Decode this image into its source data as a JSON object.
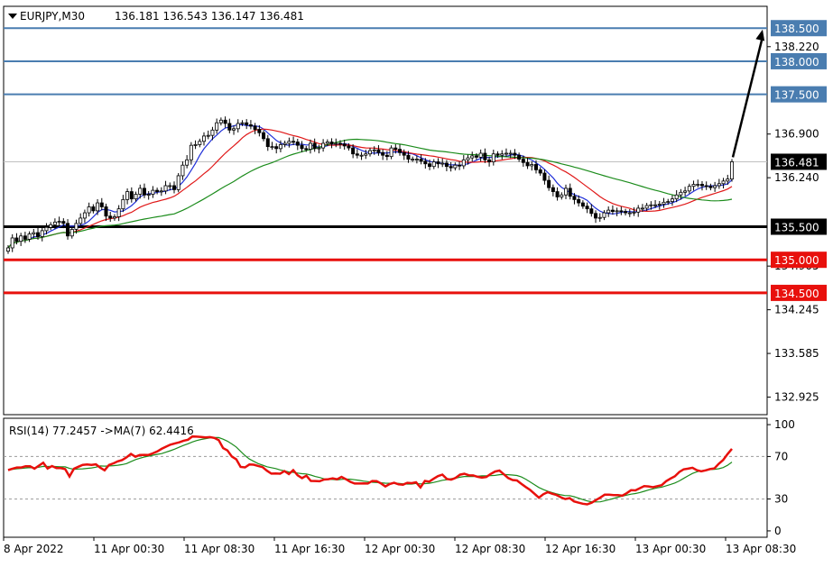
{
  "chart_data": [
    {
      "type": "candlestick",
      "header": {
        "symbol": "EURJPY,M30",
        "ohlc": "136.181 136.543 136.147 136.481"
      },
      "ylim": [
        132.66,
        138.83
      ],
      "y_ticks": [
        "138.220",
        "136.900",
        "136.240",
        "134.905",
        "134.245",
        "133.585",
        "132.925"
      ],
      "x_ticks": [
        "8 Apr 2022",
        "11 Apr 00:30",
        "11 Apr 08:30",
        "11 Apr 16:30",
        "12 Apr 00:30",
        "12 Apr 08:30",
        "12 Apr 16:30",
        "13 Apr 00:30",
        "13 Apr 08:30"
      ],
      "current_price": "136.481",
      "levels": [
        {
          "value": 138.5,
          "label": "138.500",
          "color": "#4a7db0",
          "width": 2
        },
        {
          "value": 138.0,
          "label": "138.000",
          "color": "#4a7db0",
          "width": 2
        },
        {
          "value": 137.5,
          "label": "137.500",
          "color": "#4a7db0",
          "width": 2
        },
        {
          "value": 135.5,
          "label": "135.500",
          "color": "#000000",
          "width": 3
        },
        {
          "value": 135.0,
          "label": "135.000",
          "color": "#e8100c",
          "width": 3
        },
        {
          "value": 134.5,
          "label": "134.500",
          "color": "#e8100c",
          "width": 3
        }
      ],
      "close_values": [
        135.18,
        135.33,
        135.28,
        135.36,
        135.31,
        135.39,
        135.41,
        135.35,
        135.44,
        135.49,
        135.53,
        135.57,
        135.58,
        135.55,
        135.36,
        135.46,
        135.55,
        135.63,
        135.71,
        135.8,
        135.74,
        135.86,
        135.8,
        135.66,
        135.63,
        135.65,
        135.77,
        135.91,
        136.03,
        135.92,
        135.99,
        136.08,
        135.98,
        135.99,
        136.05,
        136.03,
        136.04,
        136.12,
        136.12,
        136.06,
        136.27,
        136.43,
        136.51,
        136.73,
        136.74,
        136.79,
        136.87,
        136.88,
        136.96,
        137.07,
        137.11,
        137.06,
        136.96,
        136.98,
        137.06,
        137.07,
        137.04,
        137.02,
        136.97,
        136.92,
        136.83,
        136.71,
        136.71,
        136.68,
        136.74,
        136.76,
        136.79,
        136.78,
        136.73,
        136.68,
        136.67,
        136.76,
        136.68,
        136.69,
        136.76,
        136.78,
        136.75,
        136.76,
        136.75,
        136.72,
        136.69,
        136.6,
        136.58,
        136.58,
        136.6,
        136.65,
        136.66,
        136.62,
        136.58,
        136.56,
        136.69,
        136.67,
        136.62,
        136.58,
        136.52,
        136.52,
        136.52,
        136.49,
        136.45,
        136.41,
        136.48,
        136.45,
        136.46,
        136.41,
        136.39,
        136.43,
        136.42,
        136.51,
        136.54,
        136.57,
        136.55,
        136.61,
        136.51,
        136.48,
        136.6,
        136.58,
        136.6,
        136.61,
        136.61,
        136.58,
        136.52,
        136.47,
        136.42,
        136.44,
        136.36,
        136.31,
        136.2,
        136.09,
        136.03,
        135.95,
        135.98,
        136.08,
        135.96,
        135.91,
        135.86,
        135.81,
        135.77,
        135.7,
        135.63,
        135.64,
        135.71,
        135.75,
        135.73,
        135.74,
        135.73,
        135.71,
        135.71,
        135.72,
        135.78,
        135.78,
        135.82,
        135.83,
        135.83,
        135.84,
        135.87,
        135.88,
        135.92,
        135.98,
        136.02,
        136.04,
        136.11,
        136.14,
        136.14,
        136.12,
        136.11,
        136.09,
        136.12,
        136.15,
        136.19,
        136.22,
        136.481
      ],
      "ma_series": [
        {
          "color": "#1f2fd8"
        },
        {
          "color": "#e01818"
        },
        {
          "color": "#1c8c1c"
        }
      ],
      "target_arrow": {
        "from": 136.55,
        "to": 138.48
      }
    },
    {
      "type": "line",
      "header": "RSI(14) 77.2457  ->MA(7) 62.4416",
      "ylim": [
        -6,
        106
      ],
      "y_ticks": [
        "100",
        "70",
        "30",
        "0"
      ],
      "guides": [
        70,
        30
      ],
      "rsi_values": [
        57.21,
        58.55,
        59.69,
        59.69,
        60.84,
        60.84,
        58.59,
        61.34,
        64.13,
        58.67,
        61.07,
        59.11,
        59.11,
        58.18,
        51.23,
        58.5,
        60.39,
        62.11,
        62.5,
        62.1,
        62.66,
        59.54,
        57.05,
        62.05,
        63.55,
        65.45,
        66.69,
        69.14,
        72.52,
        69.78,
        71.35,
        71.56,
        71.45,
        72.96,
        74.78,
        77.22,
        79.3,
        81.15,
        82.3,
        83.36,
        84.89,
        85.77,
        88.84,
        88.7,
        88.35,
        87.95,
        88.29,
        87.52,
        85.45,
        77.92,
        75.72,
        69.98,
        67.41,
        60.14,
        59.77,
        62.5,
        62.29,
        61.13,
        60.05,
        56.58,
        53.92,
        54.04,
        53.84,
        56.32,
        53.48,
        57.21,
        52.33,
        49.67,
        51.92,
        47.04,
        46.95,
        46.65,
        48.29,
        48.61,
        49.52,
        48.59,
        50.84,
        48.6,
        46.22,
        44.61,
        44.56,
        44.76,
        44.61,
        46.91,
        46.76,
        44.68,
        41.88,
        44.12,
        45.23,
        43.84,
        43.43,
        45.28,
        44.9,
        45.73,
        40.91,
        47.01,
        46.36,
        49.05,
        51.52,
        52.98,
        48.89,
        48.18,
        49.93,
        52.87,
        53.8,
        52.35,
        52.24,
        50.92,
        50.2,
        50.64,
        53.55,
        55.82,
        56.82,
        53.29,
        49.76,
        47.86,
        47.47,
        44.35,
        41.23,
        38.51,
        34.93,
        31.26,
        34.49,
        36.46,
        34.96,
        33.78,
        31.69,
        29.95,
        30.79,
        27.78,
        26.57,
        25.56,
        24.95,
        26.47,
        28.95,
        31.41,
        34.01,
        34.06,
        33.65,
        33.67,
        33.14,
        35.38,
        38.25,
        38.09,
        40.17,
        42.11,
        41.84,
        41.05,
        42.1,
        43.07,
        46.76,
        49.23,
        51.32,
        55.44,
        57.92,
        58.57,
        59.4,
        57.15,
        56.14,
        56.93,
        58.11,
        58.8,
        63.11,
        66.75,
        72.23,
        77.25
      ],
      "rsi_color": "#e8100c",
      "ma_color": "#1c8c1c"
    }
  ]
}
